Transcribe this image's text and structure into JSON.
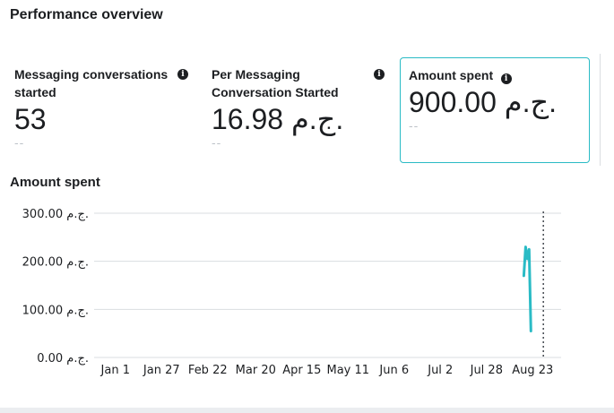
{
  "header": {
    "title": "Performance overview"
  },
  "metrics": [
    {
      "label": "Messaging conversations started",
      "value": "53",
      "delta": "--"
    },
    {
      "label": "Per Messaging Conversation Started",
      "value": "16.98 ج.م.",
      "delta": "--"
    },
    {
      "label": "Amount spent",
      "value": "900.00 ج.م.",
      "delta": "--"
    }
  ],
  "chart_section": {
    "title": "Amount spent"
  },
  "chart_data": {
    "type": "line",
    "title": "Amount spent",
    "y_tick_labels": [
      "300.00 ج.م.",
      "200.00 ج.م.",
      "100.00 ج.م.",
      "0.00 ج.م."
    ],
    "y_ticks": [
      300,
      200,
      100,
      0
    ],
    "ylim": [
      0,
      300
    ],
    "x_tick_labels": [
      "Jan 1",
      "Jan 27",
      "Feb 22",
      "Mar 20",
      "Apr 15",
      "May 11",
      "Jun 6",
      "Jul 2",
      "Jul 28",
      "Aug 23"
    ],
    "x_ticks": [
      "2024-01-01",
      "2024-01-27",
      "2024-02-22",
      "2024-03-20",
      "2024-04-15",
      "2024-05-11",
      "2024-06-06",
      "2024-07-02",
      "2024-07-28",
      "2024-08-23"
    ],
    "xlim": [
      "2023-12-20",
      "2024-09-08"
    ],
    "grid": true,
    "series": [
      {
        "color": "#2abbc5",
        "points": [
          {
            "x": "2024-08-18",
            "y": 170
          },
          {
            "x": "2024-08-19",
            "y": 230
          },
          {
            "x": "2024-08-20",
            "y": 205
          },
          {
            "x": "2024-08-21",
            "y": 225
          },
          {
            "x": "2024-08-22",
            "y": 55
          }
        ]
      }
    ],
    "marker_line": {
      "x": "2024-08-29",
      "style": "dotted"
    }
  }
}
